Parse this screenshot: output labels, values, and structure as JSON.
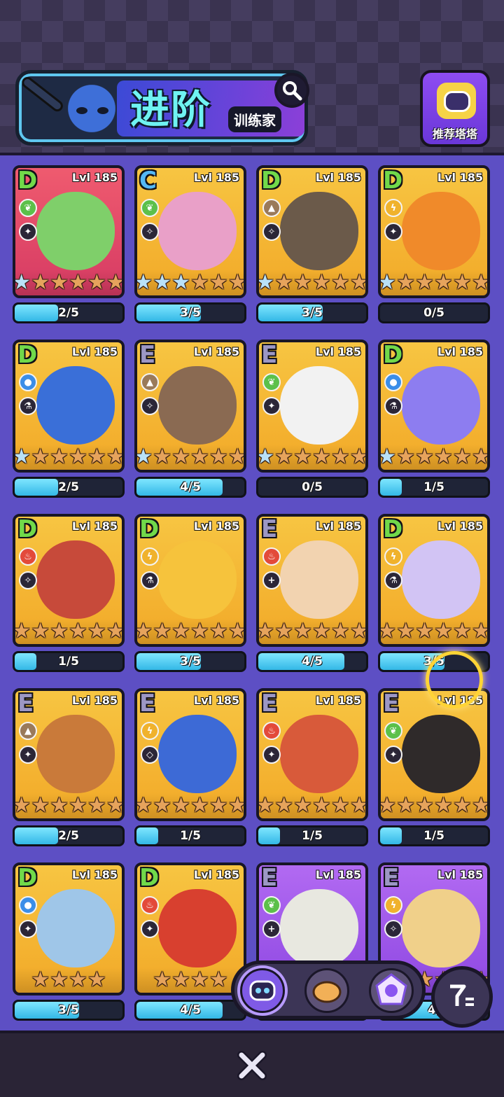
{
  "header": {
    "title": "进阶",
    "subtitle": "训练家",
    "recommend_label": "推荐塔塔"
  },
  "colors": {
    "panel": "#5d4fc4",
    "card_gold": "#f7c542",
    "card_purple": "#b26af2",
    "progress_fill": "#33b8e6"
  },
  "cards": [
    {
      "grade": "D",
      "level": "Lvl 185",
      "element": "leaf",
      "role": "sword",
      "blue_stars": 1,
      "progress": "2/5",
      "fill": 0.4,
      "bg": "pink"
    },
    {
      "grade": "C",
      "level": "Lvl 185",
      "element": "leaf",
      "role": "mage",
      "blue_stars": 3,
      "progress": "3/5",
      "fill": 0.6,
      "bg": "gold"
    },
    {
      "grade": "D",
      "level": "Lvl 185",
      "element": "earth",
      "role": "mage",
      "blue_stars": 1,
      "progress": "3/5",
      "fill": 0.6,
      "bg": "gold"
    },
    {
      "grade": "D",
      "level": "Lvl 185",
      "element": "thunder",
      "role": "sword",
      "blue_stars": 1,
      "progress": "0/5",
      "fill": 0.0,
      "bg": "gold"
    },
    {
      "grade": "D",
      "level": "Lvl 185",
      "element": "water",
      "role": "potion",
      "blue_stars": 1,
      "progress": "2/5",
      "fill": 0.4,
      "bg": "gold"
    },
    {
      "grade": "E",
      "level": "Lvl 185",
      "element": "earth",
      "role": "mage",
      "blue_stars": 1,
      "progress": "4/5",
      "fill": 0.8,
      "bg": "gold"
    },
    {
      "grade": "E",
      "level": "Lvl 185",
      "element": "leaf",
      "role": "sword",
      "blue_stars": 1,
      "progress": "0/5",
      "fill": 0.0,
      "bg": "gold"
    },
    {
      "grade": "D",
      "level": "Lvl 185",
      "element": "water",
      "role": "potion",
      "blue_stars": 1,
      "progress": "1/5",
      "fill": 0.2,
      "bg": "gold"
    },
    {
      "grade": "D",
      "level": "Lvl 185",
      "element": "fire",
      "role": "mage",
      "blue_stars": 0,
      "progress": "1/5",
      "fill": 0.2,
      "bg": "gold"
    },
    {
      "grade": "D",
      "level": "Lvl 185",
      "element": "thunder",
      "role": "potion",
      "blue_stars": 0,
      "progress": "3/5",
      "fill": 0.6,
      "bg": "gold"
    },
    {
      "grade": "E",
      "level": "Lvl 185",
      "element": "fire",
      "role": "heal",
      "blue_stars": 0,
      "progress": "4/5",
      "fill": 0.8,
      "bg": "gold"
    },
    {
      "grade": "D",
      "level": "Lvl 185",
      "element": "thunder",
      "role": "potion",
      "blue_stars": 0,
      "progress": "3/5",
      "fill": 0.6,
      "bg": "gold"
    },
    {
      "grade": "E",
      "level": "Lvl 185",
      "element": "earth",
      "role": "sword",
      "blue_stars": 0,
      "progress": "2/5",
      "fill": 0.4,
      "bg": "gold"
    },
    {
      "grade": "E",
      "level": "Lvl 185",
      "element": "thunder",
      "role": "shield",
      "blue_stars": 0,
      "progress": "1/5",
      "fill": 0.2,
      "bg": "gold"
    },
    {
      "grade": "E",
      "level": "Lvl 185",
      "element": "fire",
      "role": "sword",
      "blue_stars": 0,
      "progress": "1/5",
      "fill": 0.2,
      "bg": "gold"
    },
    {
      "grade": "E",
      "level": "Lvl 185",
      "element": "leaf",
      "role": "sword",
      "blue_stars": 0,
      "progress": "1/5",
      "fill": 0.2,
      "bg": "gold"
    },
    {
      "grade": "D",
      "level": "Lvl 185",
      "element": "water",
      "role": "sword",
      "blue_stars": 0,
      "star_count": 4,
      "progress": "3/5",
      "fill": 0.6,
      "bg": "gold"
    },
    {
      "grade": "D",
      "level": "Lvl 185",
      "element": "fire",
      "role": "sword",
      "blue_stars": 0,
      "star_count": 4,
      "progress": "4/5",
      "fill": 0.8,
      "bg": "gold"
    },
    {
      "grade": "E",
      "level": "Lvl 185",
      "element": "leaf",
      "role": "heal",
      "blue_stars": 0,
      "progress": "",
      "fill": 0.0,
      "bg": "purple"
    },
    {
      "grade": "E",
      "level": "Lvl 185",
      "element": "thunder",
      "role": "mage",
      "blue_stars": 0,
      "progress": "4/",
      "fill": 0.8,
      "bg": "purple"
    }
  ],
  "filters": [
    "tata-filter-icon",
    "bread-filter-icon",
    "crystal-filter-icon"
  ],
  "sort_icon": "sort-icon",
  "close_icon": "close-icon"
}
